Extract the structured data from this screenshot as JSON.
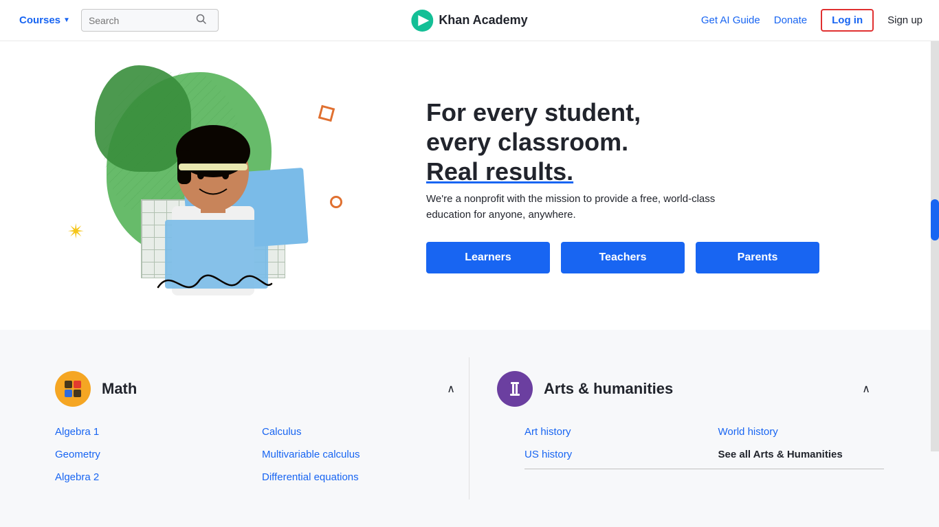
{
  "navbar": {
    "courses_label": "Courses",
    "search_placeholder": "Search",
    "brand_name": "Khan Academy",
    "get_ai_guide": "Get AI Guide",
    "donate": "Donate",
    "login": "Log in",
    "signup": "Sign up"
  },
  "hero": {
    "headline_line1": "For every student,",
    "headline_line2": "every classroom.",
    "headline_line3": "Real results.",
    "subtext": "We're a nonprofit with the mission to provide a free, world-class education for anyone, anywhere.",
    "btn_learners": "Learners",
    "btn_teachers": "Teachers",
    "btn_parents": "Parents"
  },
  "math": {
    "title": "Math",
    "links_col1": [
      "Algebra 1",
      "Geometry",
      "Algebra 2"
    ],
    "links_col2": [
      "Calculus",
      "Multivariable calculus",
      "Differential equations"
    ]
  },
  "arts": {
    "title": "Arts & humanities",
    "links_col1": [
      "Art history",
      "US history"
    ],
    "links_col2": [
      "World history",
      "See all Arts & Humanities"
    ]
  }
}
